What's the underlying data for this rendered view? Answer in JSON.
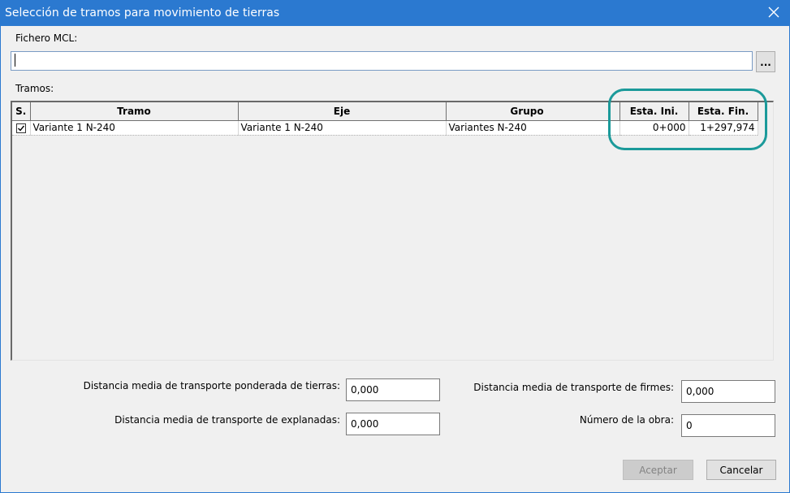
{
  "window": {
    "title": "Selección de tramos para movimiento de tierras",
    "close_icon": "close-icon"
  },
  "file": {
    "label": "Fichero MCL:",
    "value": "",
    "browse_label": "..."
  },
  "tramos": {
    "label": "Tramos:",
    "columns": [
      "S.",
      "Tramo",
      "Eje",
      "Grupo",
      "Esta. Ini.",
      "Esta. Fin."
    ],
    "rows": [
      {
        "checked": true,
        "tramo": "Variante 1 N-240",
        "eje": "Variante 1 N-240",
        "grupo": "Variantes N-240",
        "esta_ini": "0+000",
        "esta_fin": "1+297,974"
      }
    ]
  },
  "fields": {
    "tierras_label": "Distancia media de transporte ponderada de tierras:",
    "tierras_value": "0,000",
    "explanadas_label": "Distancia media de transporte de explanadas:",
    "explanadas_value": "0,000",
    "firmes_label": "Distancia media de transporte de firmes:",
    "firmes_value": "0,000",
    "obra_label": "Número de la obra:",
    "obra_value": "0"
  },
  "buttons": {
    "accept": "Aceptar",
    "cancel": "Cancelar"
  },
  "colors": {
    "titlebar": "#2b79d0",
    "highlight": "#1b9a9a"
  }
}
